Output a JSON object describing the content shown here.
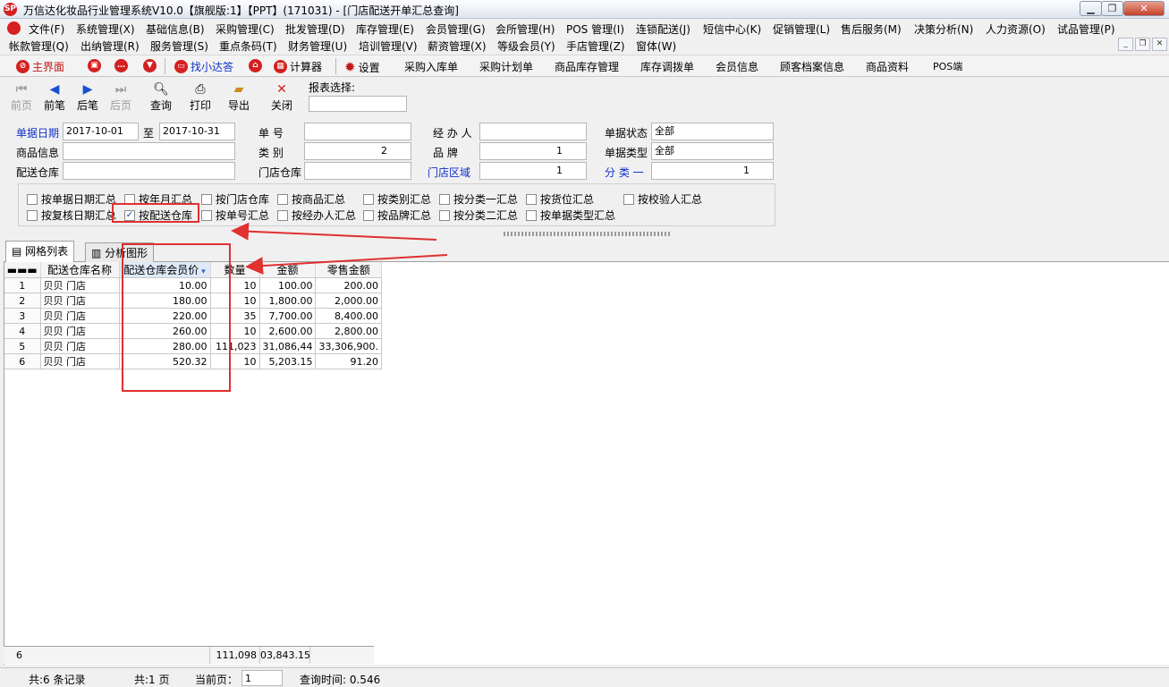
{
  "window": {
    "title": "万信达化妆品行业管理系统V10.0【旗舰版:1】【PPT】(171031) - [门店配送开单汇总查询]",
    "logo": "SP"
  },
  "menu1": [
    "文件(F)",
    "系统管理(X)",
    "基础信息(B)",
    "采购管理(C)",
    "批发管理(D)",
    "库存管理(E)",
    "会员管理(G)",
    "会所管理(H)",
    "POS 管理(I)",
    "连锁配送(J)",
    "短信中心(K)",
    "促销管理(L)",
    "售后服务(M)",
    "决策分析(N)",
    "人力资源(O)",
    "试品管理(P)"
  ],
  "menu2": [
    "帐款管理(Q)",
    "出纳管理(R)",
    "服务管理(S)",
    "重点条码(T)",
    "财务管理(U)",
    "培训管理(V)",
    "薪资管理(X)",
    "等级会员(Y)",
    "手店管理(Z)",
    "窗体(W)"
  ],
  "quickbar": {
    "main": "主界面",
    "find": "找小达答",
    "calc": "计算器",
    "settings": "设置",
    "links": [
      "采购入库单",
      "采购计划单",
      "商品库存管理",
      "库存调拨单",
      "会员信息",
      "顾客档案信息",
      "商品资料",
      "POS端"
    ]
  },
  "toolbar": {
    "prev_page": "前页",
    "prev": "前笔",
    "next": "后笔",
    "next_page": "后页",
    "query": "查询",
    "print": "打印",
    "export": "导出",
    "close": "关闭",
    "report_select": "报表选择:"
  },
  "filter": {
    "date_label": "单据日期",
    "date_from": "2017-10-01",
    "to": "至",
    "date_to": "2017-10-31",
    "doc_no": "单      号",
    "handler": "经 办 人",
    "doc_status": "单据状态",
    "doc_status_val": "全部",
    "goods": "商品信息",
    "category": "类      别",
    "category_num": "2",
    "brand": "品      牌",
    "brand_num": "1",
    "doc_type": "单据类型",
    "doc_type_val": "全部",
    "warehouse": "配送仓库",
    "store_wh": "门店仓库",
    "store_area": "门店区域",
    "area_num": "1",
    "class1": "分  类  一",
    "class1_num": "1"
  },
  "checks": {
    "row1": [
      "按单据日期汇总",
      "按年月汇总",
      "按门店仓库",
      "按商品汇总",
      "按类别汇总",
      "按分类一汇总",
      "按货位汇总",
      "按校验人汇总"
    ],
    "row2": [
      "按复核日期汇总",
      "按配送仓库",
      "按单号汇总",
      "按经办人汇总",
      "按品牌汇总",
      "按分类二汇总",
      "按单据类型汇总"
    ],
    "checked": "按配送仓库"
  },
  "tabs": {
    "grid": "网格列表",
    "chart": "分析图形"
  },
  "grid": {
    "headers": [
      "配送仓库名称",
      "配送仓库会员价",
      "数量",
      "金额",
      "零售金额"
    ],
    "rows": [
      [
        "1",
        "贝贝 门店",
        "10.00",
        "10",
        "100.00",
        "200.00"
      ],
      [
        "2",
        "贝贝 门店",
        "180.00",
        "10",
        "1,800.00",
        "2,000.00"
      ],
      [
        "3",
        "贝贝 门店",
        "220.00",
        "35",
        "7,700.00",
        "8,400.00"
      ],
      [
        "4",
        "贝贝 门店",
        "260.00",
        "10",
        "2,600.00",
        "2,800.00"
      ],
      [
        "5",
        "贝贝 门店",
        "280.00",
        "111,023",
        "31,086,44",
        "33,306,900."
      ],
      [
        "6",
        "贝贝 门店",
        "520.32",
        "10",
        "5,203.15",
        "91.20"
      ]
    ],
    "footer": {
      "count": "6",
      "qty": "111,098",
      "amount": "03,843.15"
    }
  },
  "status": {
    "records": "共:6 条记录",
    "pages": "共:1 页",
    "current_label": "当前页：",
    "current_val": "1",
    "query_time": "查询时间: 0.546"
  },
  "colors": {
    "red": "#e03030",
    "blue_label": "#1030c8"
  }
}
